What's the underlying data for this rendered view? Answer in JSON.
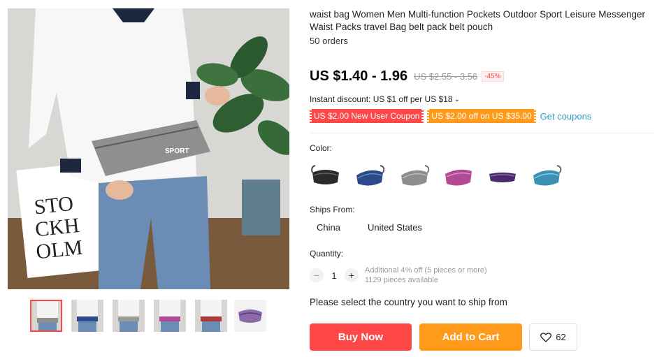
{
  "product": {
    "title": "waist bag Women Men Multi-function Pockets Outdoor Sport Leisure Messenger Waist Packs travel Bag belt pack belt pouch",
    "orders": "50 orders"
  },
  "gallery": {
    "main_image_icon": "product-photo-woman-wearing-gray-waist-bag",
    "sign_text_lines": [
      "STO",
      "CKH",
      "OLM"
    ],
    "bag_logo": "SPORT",
    "thumbnails": [
      {
        "icon": "thumb-gray-bag",
        "active": true
      },
      {
        "icon": "thumb-blue-bag",
        "active": false
      },
      {
        "icon": "thumb-gray-bag-2",
        "active": false
      },
      {
        "icon": "thumb-pink-bag",
        "active": false
      },
      {
        "icon": "thumb-red-bag",
        "active": false
      },
      {
        "icon": "thumb-purple-bag",
        "active": false
      }
    ]
  },
  "pricing": {
    "price": "US $1.40 - 1.96",
    "original_price": "US $2.55 - 3.56",
    "discount_percent": "-45%",
    "instant_discount": "Instant discount: US $1 off per US $18",
    "coupons": [
      "US $2.00 New User Coupon",
      "US $2.00 off on US $35.00"
    ],
    "get_coupons_label": "Get coupons"
  },
  "options": {
    "color_label": "Color:",
    "colors": [
      {
        "name": "black",
        "hex": "#2b2b2b"
      },
      {
        "name": "navy",
        "hex": "#2a4a8a"
      },
      {
        "name": "gray",
        "hex": "#8d8d8d"
      },
      {
        "name": "pink",
        "hex": "#b04a94"
      },
      {
        "name": "purple",
        "hex": "#4a2a6e"
      },
      {
        "name": "sky-blue",
        "hex": "#3e8fb4"
      }
    ],
    "ships_from_label": "Ships From:",
    "ships_from": [
      "China",
      "United States"
    ],
    "quantity_label": "Quantity:",
    "quantity": "1",
    "minus": "−",
    "plus": "+",
    "additional_discount": "Additional 4% off (5 pieces or more)",
    "available": "1129 pieces available",
    "ship_message": "Please select the country you want to ship from"
  },
  "actions": {
    "buy_now": "Buy Now",
    "add_to_cart": "Add to Cart",
    "wishlist_count": "62"
  },
  "colors": {
    "accent_red": "#ff4747",
    "accent_orange": "#ff9a1a",
    "link_blue": "#2e9cc3"
  }
}
